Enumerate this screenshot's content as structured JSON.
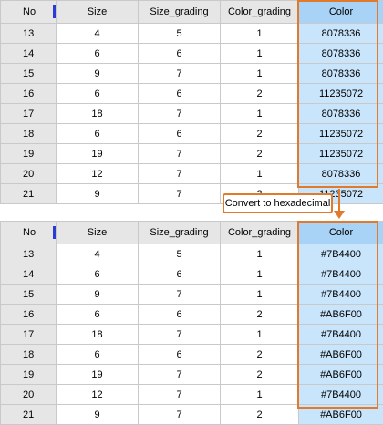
{
  "columns": [
    "No",
    "Size",
    "Size_grading",
    "Color_grading",
    "Color"
  ],
  "top_table": {
    "rows": [
      [
        "13",
        "4",
        "5",
        "1",
        "8078336"
      ],
      [
        "14",
        "6",
        "6",
        "1",
        "8078336"
      ],
      [
        "15",
        "9",
        "7",
        "1",
        "8078336"
      ],
      [
        "16",
        "6",
        "6",
        "2",
        "11235072"
      ],
      [
        "17",
        "18",
        "7",
        "1",
        "8078336"
      ],
      [
        "18",
        "6",
        "6",
        "2",
        "11235072"
      ],
      [
        "19",
        "19",
        "7",
        "2",
        "11235072"
      ],
      [
        "20",
        "12",
        "7",
        "1",
        "8078336"
      ],
      [
        "21",
        "9",
        "7",
        "2",
        "11235072"
      ]
    ]
  },
  "callout_label": "Convert to hexadecimal",
  "bottom_table": {
    "rows": [
      [
        "13",
        "4",
        "5",
        "1",
        "#7B4400"
      ],
      [
        "14",
        "6",
        "6",
        "1",
        "#7B4400"
      ],
      [
        "15",
        "9",
        "7",
        "1",
        "#7B4400"
      ],
      [
        "16",
        "6",
        "6",
        "2",
        "#AB6F00"
      ],
      [
        "17",
        "18",
        "7",
        "1",
        "#7B4400"
      ],
      [
        "18",
        "6",
        "6",
        "2",
        "#AB6F00"
      ],
      [
        "19",
        "19",
        "7",
        "2",
        "#AB6F00"
      ],
      [
        "20",
        "12",
        "7",
        "1",
        "#7B4400"
      ],
      [
        "21",
        "9",
        "7",
        "2",
        "#AB6F00"
      ]
    ]
  },
  "colors": {
    "highlight_border": "#e07b2d",
    "header_bg": "#e6e6e6",
    "color_header_bg": "#a8d2f6",
    "color_cell_bg": "#c9e5fb",
    "column_marker": "#2a3bd6"
  }
}
